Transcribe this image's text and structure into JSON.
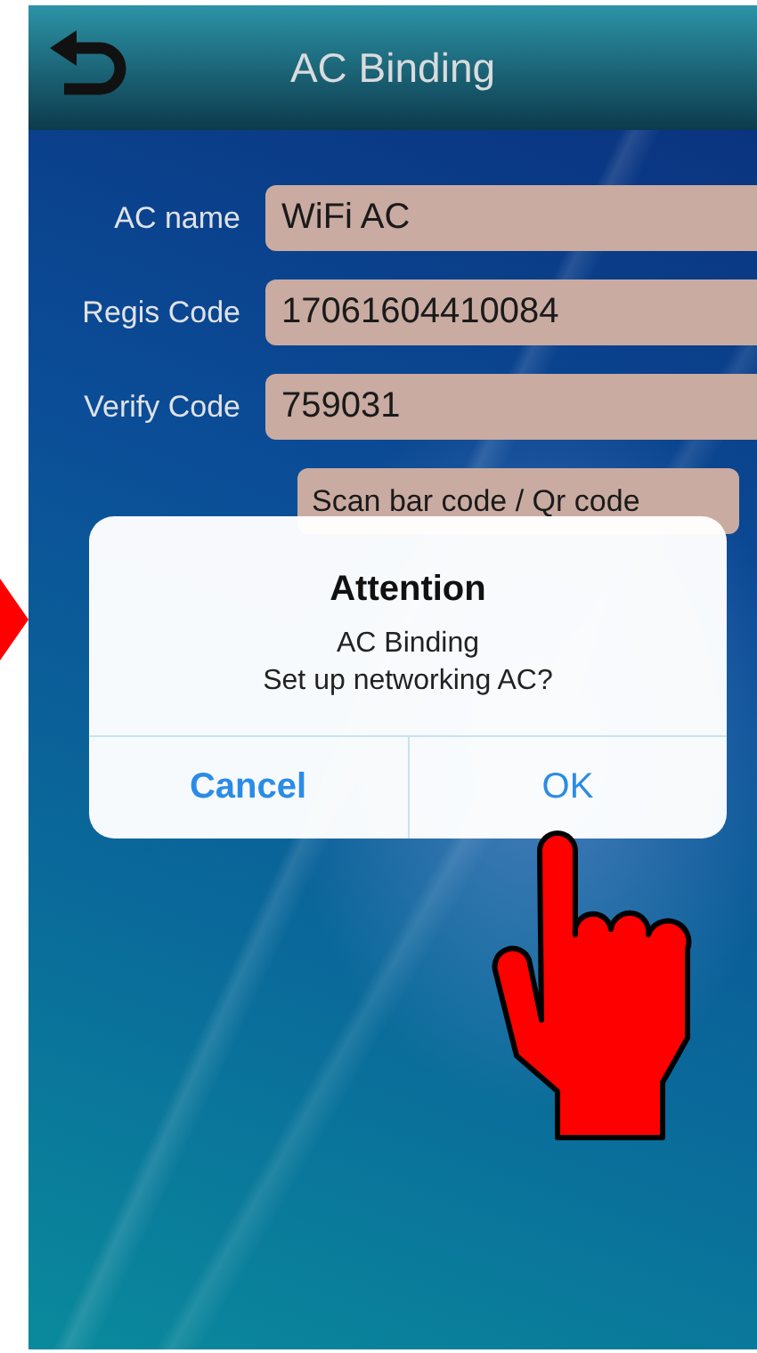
{
  "header": {
    "title": "AC Binding"
  },
  "fields": [
    {
      "label": "AC name",
      "value": "WiFi AC"
    },
    {
      "label": "Regis Code",
      "value": "17061604410084"
    },
    {
      "label": "Verify Code",
      "value": "759031"
    }
  ],
  "scan_button": {
    "label": "Scan bar code / Qr code"
  },
  "dialog": {
    "title": "Attention",
    "message_lines": [
      "AC Binding",
      "Set up networking AC?"
    ],
    "buttons": [
      {
        "label": "Cancel",
        "kind": "cancel"
      },
      {
        "label": "OK",
        "kind": "ok"
      }
    ]
  }
}
